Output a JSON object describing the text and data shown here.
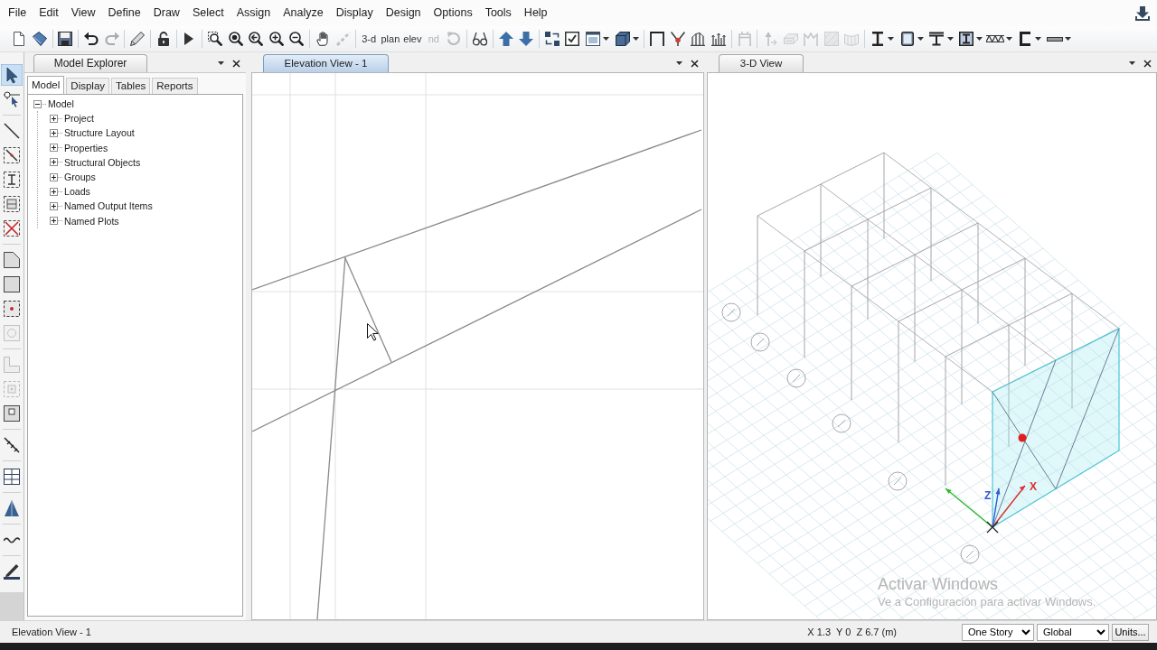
{
  "menu": [
    "File",
    "Edit",
    "View",
    "Define",
    "Draw",
    "Select",
    "Assign",
    "Analyze",
    "Display",
    "Design",
    "Options",
    "Tools",
    "Help"
  ],
  "toolbar": [
    [
      {
        "kind": "icon",
        "disabled": false,
        "dropdown": false
      },
      {
        "kind": "icon",
        "disabled": false,
        "dropdown": false
      }
    ],
    [
      {
        "kind": "icon",
        "disabled": false,
        "dropdown": false
      }
    ],
    [
      {
        "kind": "icon",
        "disabled": false,
        "dropdown": false
      },
      {
        "kind": "icon",
        "disabled": true,
        "dropdown": false
      }
    ],
    [
      {
        "kind": "icon",
        "disabled": false,
        "dropdown": false
      }
    ],
    [
      {
        "kind": "icon",
        "disabled": false,
        "dropdown": false
      }
    ],
    [
      {
        "kind": "icon",
        "disabled": false,
        "dropdown": false
      }
    ],
    [
      {
        "kind": "icon",
        "disabled": false,
        "dropdown": false
      },
      {
        "kind": "icon",
        "disabled": false,
        "dropdown": false
      },
      {
        "kind": "icon",
        "disabled": false,
        "dropdown": false
      },
      {
        "kind": "icon",
        "disabled": false,
        "dropdown": false
      },
      {
        "kind": "icon",
        "disabled": false,
        "dropdown": false
      }
    ],
    [
      {
        "kind": "icon",
        "disabled": false,
        "dropdown": false
      },
      {
        "kind": "icon",
        "disabled": true,
        "dropdown": false
      }
    ],
    [
      {
        "kind": "text",
        "label": "3-d",
        "disabled": false,
        "dropdown": false
      },
      {
        "kind": "text",
        "label": "plan",
        "disabled": false,
        "dropdown": false
      },
      {
        "kind": "text",
        "label": "elev",
        "disabled": false,
        "dropdown": false
      },
      {
        "kind": "text",
        "label": "nd",
        "disabled": true,
        "dropdown": false
      },
      {
        "kind": "icon",
        "disabled": true,
        "dropdown": false
      }
    ],
    [
      {
        "kind": "icon",
        "disabled": false,
        "dropdown": false
      }
    ],
    [
      {
        "kind": "icon",
        "disabled": false,
        "dropdown": false
      },
      {
        "kind": "icon",
        "disabled": false,
        "dropdown": false
      }
    ],
    [
      {
        "kind": "icon",
        "disabled": false,
        "dropdown": false
      },
      {
        "kind": "icon",
        "disabled": false,
        "dropdown": false
      },
      {
        "kind": "icon",
        "disabled": false,
        "dropdown": true
      },
      {
        "kind": "icon",
        "disabled": false,
        "dropdown": true
      }
    ],
    [
      {
        "kind": "icon",
        "disabled": false,
        "dropdown": false
      },
      {
        "kind": "icon",
        "disabled": false,
        "dropdown": false
      },
      {
        "kind": "icon",
        "disabled": false,
        "dropdown": false
      },
      {
        "kind": "icon",
        "disabled": false,
        "dropdown": false
      }
    ],
    [
      {
        "kind": "icon",
        "disabled": true,
        "dropdown": false
      }
    ],
    [
      {
        "kind": "icon",
        "disabled": true,
        "dropdown": false
      },
      {
        "kind": "icon",
        "disabled": true,
        "dropdown": false
      },
      {
        "kind": "icon",
        "disabled": true,
        "dropdown": false
      },
      {
        "kind": "icon",
        "disabled": true,
        "dropdown": false
      },
      {
        "kind": "icon",
        "disabled": true,
        "dropdown": false
      }
    ],
    [
      {
        "kind": "icon",
        "disabled": false,
        "dropdown": true
      },
      {
        "kind": "icon",
        "disabled": false,
        "dropdown": true
      },
      {
        "kind": "icon",
        "disabled": false,
        "dropdown": true
      },
      {
        "kind": "icon",
        "disabled": false,
        "dropdown": true
      },
      {
        "kind": "icon",
        "disabled": false,
        "dropdown": true
      },
      {
        "kind": "icon",
        "disabled": false,
        "dropdown": true
      },
      {
        "kind": "icon",
        "disabled": false,
        "dropdown": true
      }
    ]
  ],
  "draw_tools": [
    [
      {
        "selected": true,
        "disabled": false
      },
      {
        "selected": false,
        "disabled": false
      }
    ],
    [
      {
        "selected": false,
        "disabled": false
      },
      {
        "selected": false,
        "disabled": false
      },
      {
        "selected": false,
        "disabled": false
      },
      {
        "selected": false,
        "disabled": false
      },
      {
        "selected": false,
        "disabled": false
      }
    ],
    [
      {
        "selected": false,
        "disabled": false
      },
      {
        "selected": false,
        "disabled": false
      },
      {
        "selected": false,
        "disabled": false
      },
      {
        "selected": false,
        "disabled": true
      }
    ],
    [
      {
        "selected": false,
        "disabled": true
      },
      {
        "selected": false,
        "disabled": true
      },
      {
        "selected": false,
        "disabled": false
      }
    ],
    [
      {
        "selected": false,
        "disabled": false
      }
    ],
    [
      {
        "selected": false,
        "disabled": false
      }
    ],
    [
      {
        "selected": false,
        "disabled": false
      }
    ],
    [
      {
        "selected": false,
        "disabled": false
      }
    ],
    [
      {
        "selected": false,
        "disabled": false
      }
    ]
  ],
  "model_explorer": {
    "title": "Model Explorer",
    "tabs": [
      {
        "label": "Model",
        "selected": true
      },
      {
        "label": "Display",
        "selected": false
      },
      {
        "label": "Tables",
        "selected": false
      },
      {
        "label": "Reports",
        "selected": false
      }
    ],
    "tree": [
      {
        "label": "Model",
        "expanded": true,
        "children": [
          {
            "label": "Project",
            "expanded": false
          },
          {
            "label": "Structure Layout",
            "expanded": false
          },
          {
            "label": "Properties",
            "expanded": false
          },
          {
            "label": "Structural Objects",
            "expanded": false
          },
          {
            "label": "Groups",
            "expanded": false
          },
          {
            "label": "Loads",
            "expanded": false
          },
          {
            "label": "Named Output Items",
            "expanded": false
          },
          {
            "label": "Named Plots",
            "expanded": false
          }
        ]
      }
    ]
  },
  "views": [
    {
      "kind": "elevation",
      "title": "Elevation View - 1",
      "selected": true
    },
    {
      "kind": "perspective",
      "title": "3-D View",
      "selected": false,
      "axis_labels": [
        {
          "text": "Z",
          "color": "#2b57d9"
        },
        {
          "text": "X",
          "color": "#d93030"
        }
      ]
    }
  ],
  "activation_notice": {
    "title": "Activar Windows",
    "text": "Ve a Configuración para activar Windows."
  },
  "status_bar": {
    "view": "Elevation View - 1",
    "coordinates": "X 1.3  Y 0  Z 6.7 (m)",
    "story": "One Story",
    "coordinate_system": "Global",
    "units_button": "Units..."
  }
}
